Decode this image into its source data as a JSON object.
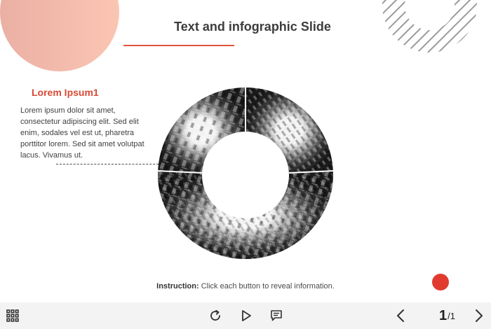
{
  "slide": {
    "title": "Text and infographic Slide",
    "subheading": "Lorem Ipsum1",
    "body": "Lorem ipsum dolor sit amet, consectetur adipiscing elit. Sed elit enim, sodales vel est ut, pharetra porttitor lorem. Sed sit amet volutpat lacus. Vivamus ut.",
    "instruction_label": "Instruction:",
    "instruction_text": " Click each button to reveal information."
  },
  "colors": {
    "accent": "#e0533f",
    "subheading": "#d94a36",
    "dot": "#e03b2e",
    "peach_start": "#eab0a4",
    "peach_end": "#fbc5b3",
    "toolbar_bg": "#f3f3f3"
  },
  "toolbar": {
    "icons": {
      "menu": "grid-menu-icon",
      "replay": "replay-icon",
      "play": "play-icon",
      "captions": "captions-icon",
      "prev": "chevron-left-icon",
      "next": "chevron-right-icon"
    },
    "page_current": "1",
    "page_total": "/1"
  }
}
